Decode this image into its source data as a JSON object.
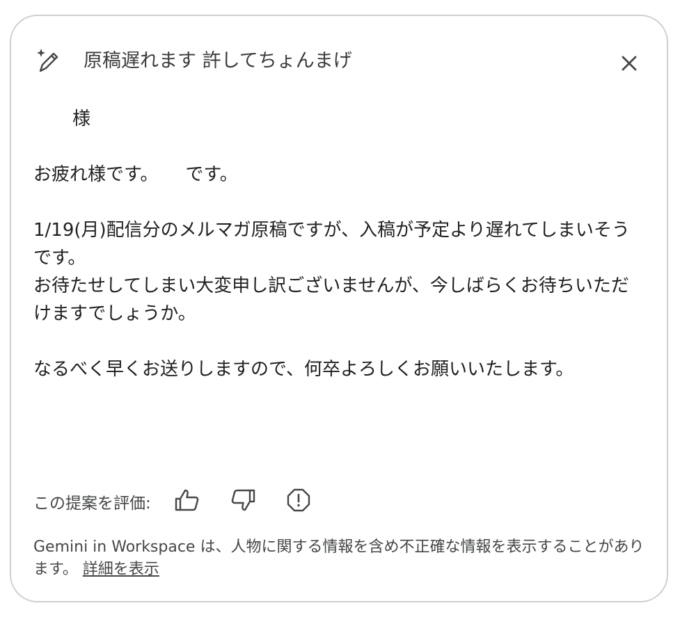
{
  "header": {
    "title": "原稿遅れます 許してちょんまげ",
    "icon": "pen-sparkle-icon",
    "close_icon": "close-icon"
  },
  "body": {
    "salutation": "様",
    "greeting": "お疲れ様です。　　です。",
    "paragraph1_line1": "1/19(月)配信分のメルマガ原稿ですが、入稿が予定より遅れてしまいそうです。",
    "paragraph1_line2": "お待たせしてしまい大変申し訳ございませんが、今しばらくお待ちいただけますでしょうか。",
    "closing": "なるべく早くお送りしますので、何卒よろしくお願いいたします。"
  },
  "rating": {
    "label": "この提案を評価:",
    "thumbs_up_icon": "thumbs-up-icon",
    "thumbs_down_icon": "thumbs-down-icon",
    "report_icon": "report-icon"
  },
  "disclaimer": {
    "text": "Gemini in Workspace は、人物に関する情報を含め不正確な情報を表示することがあります。 ",
    "link": "詳細を表示"
  }
}
